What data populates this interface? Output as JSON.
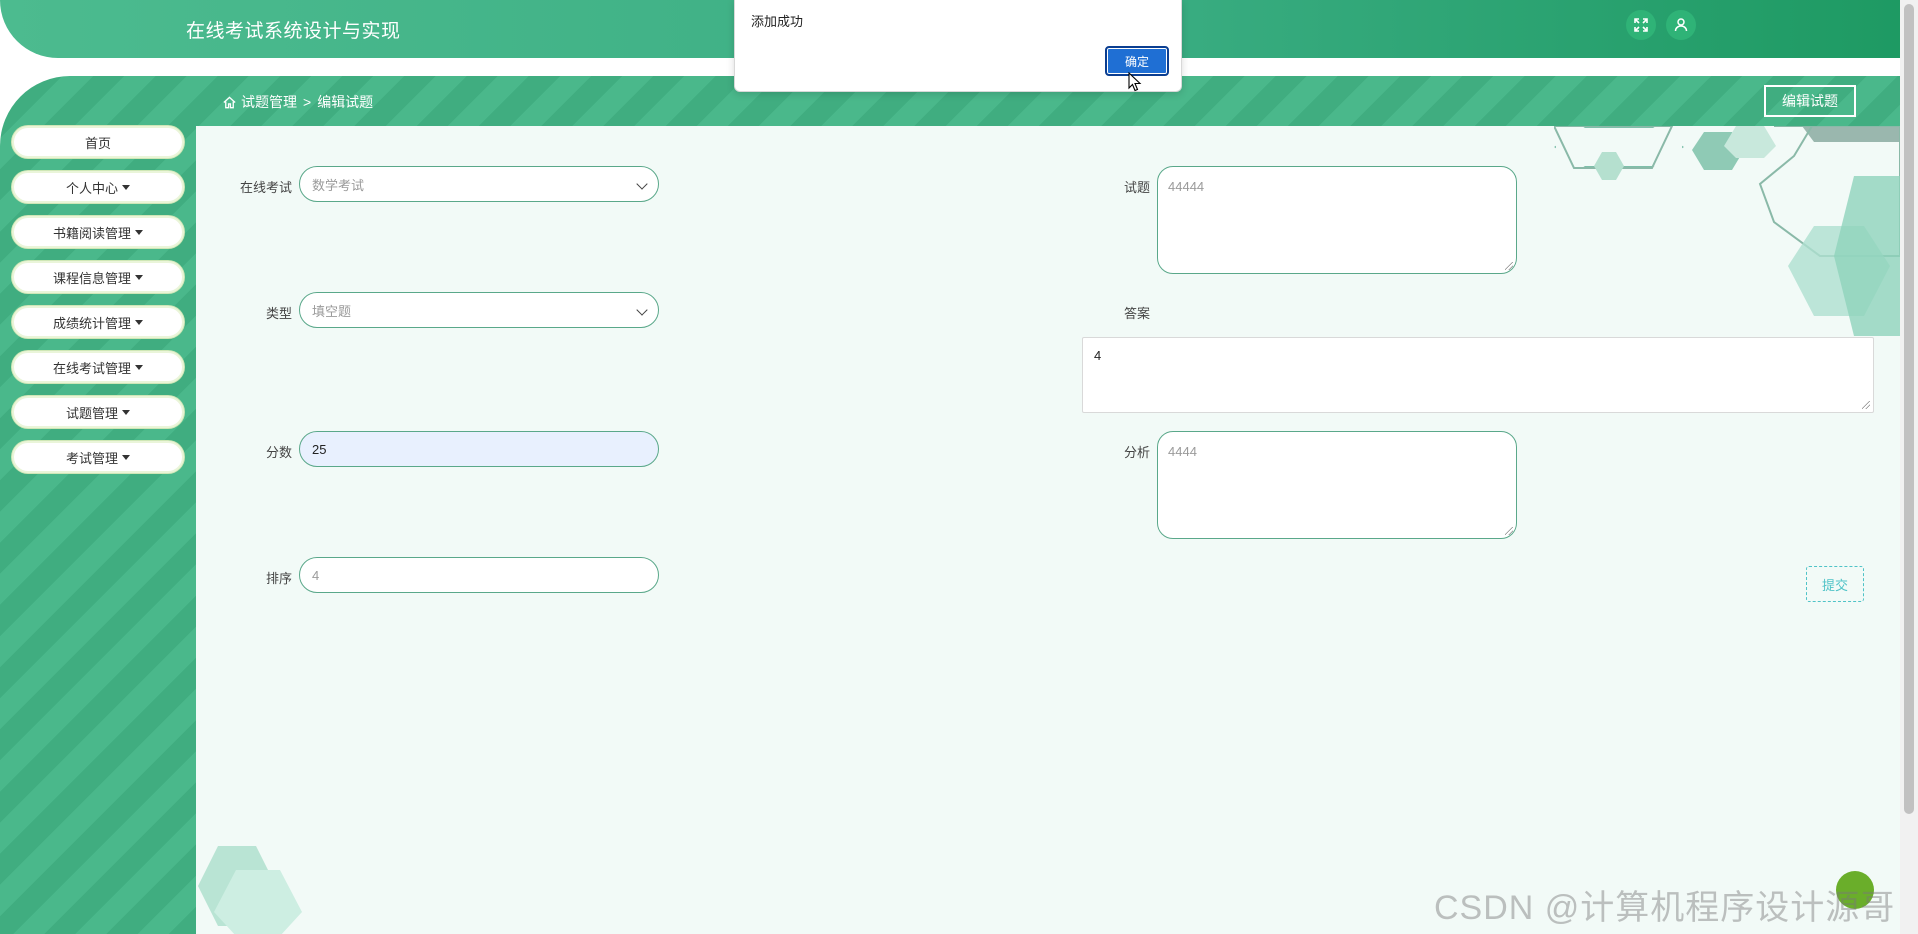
{
  "app": {
    "title": "在线考试系统设计与实现"
  },
  "header_icons": [
    {
      "icon": "fullscreen-icon"
    },
    {
      "icon": "user-icon"
    }
  ],
  "sidebar": {
    "items": [
      {
        "label": "首页",
        "has_dropdown": false
      },
      {
        "label": "个人中心",
        "has_dropdown": true
      },
      {
        "label": "书籍阅读管理",
        "has_dropdown": true
      },
      {
        "label": "课程信息管理",
        "has_dropdown": true
      },
      {
        "label": "成绩统计管理",
        "has_dropdown": true
      },
      {
        "label": "在线考试管理",
        "has_dropdown": true
      },
      {
        "label": "试题管理",
        "has_dropdown": true
      },
      {
        "label": "考试管理",
        "has_dropdown": true
      }
    ]
  },
  "breadcrumb": {
    "parent": "试题管理",
    "separator": ">",
    "current": "编辑试题"
  },
  "page_action": {
    "label": "编辑试题"
  },
  "form": {
    "exam": {
      "label": "在线考试",
      "value": "数学考试"
    },
    "type": {
      "label": "类型",
      "value": "填空题"
    },
    "score": {
      "label": "分数",
      "value": "25"
    },
    "order": {
      "label": "排序",
      "placeholder": "4"
    },
    "question": {
      "label": "试题",
      "placeholder": "44444"
    },
    "answer": {
      "label": "答案",
      "value": "4"
    },
    "analysis": {
      "label": "分析",
      "placeholder": "4444"
    },
    "submit_label": "提交"
  },
  "dialog": {
    "message": "添加成功",
    "ok_label": "确定"
  },
  "watermark": "CSDN @计算机程序设计源哥",
  "colors": {
    "primary_green": "#3aad82",
    "accent_teal": "#4fc3c7",
    "dialog_blue": "#1f6fd4"
  }
}
